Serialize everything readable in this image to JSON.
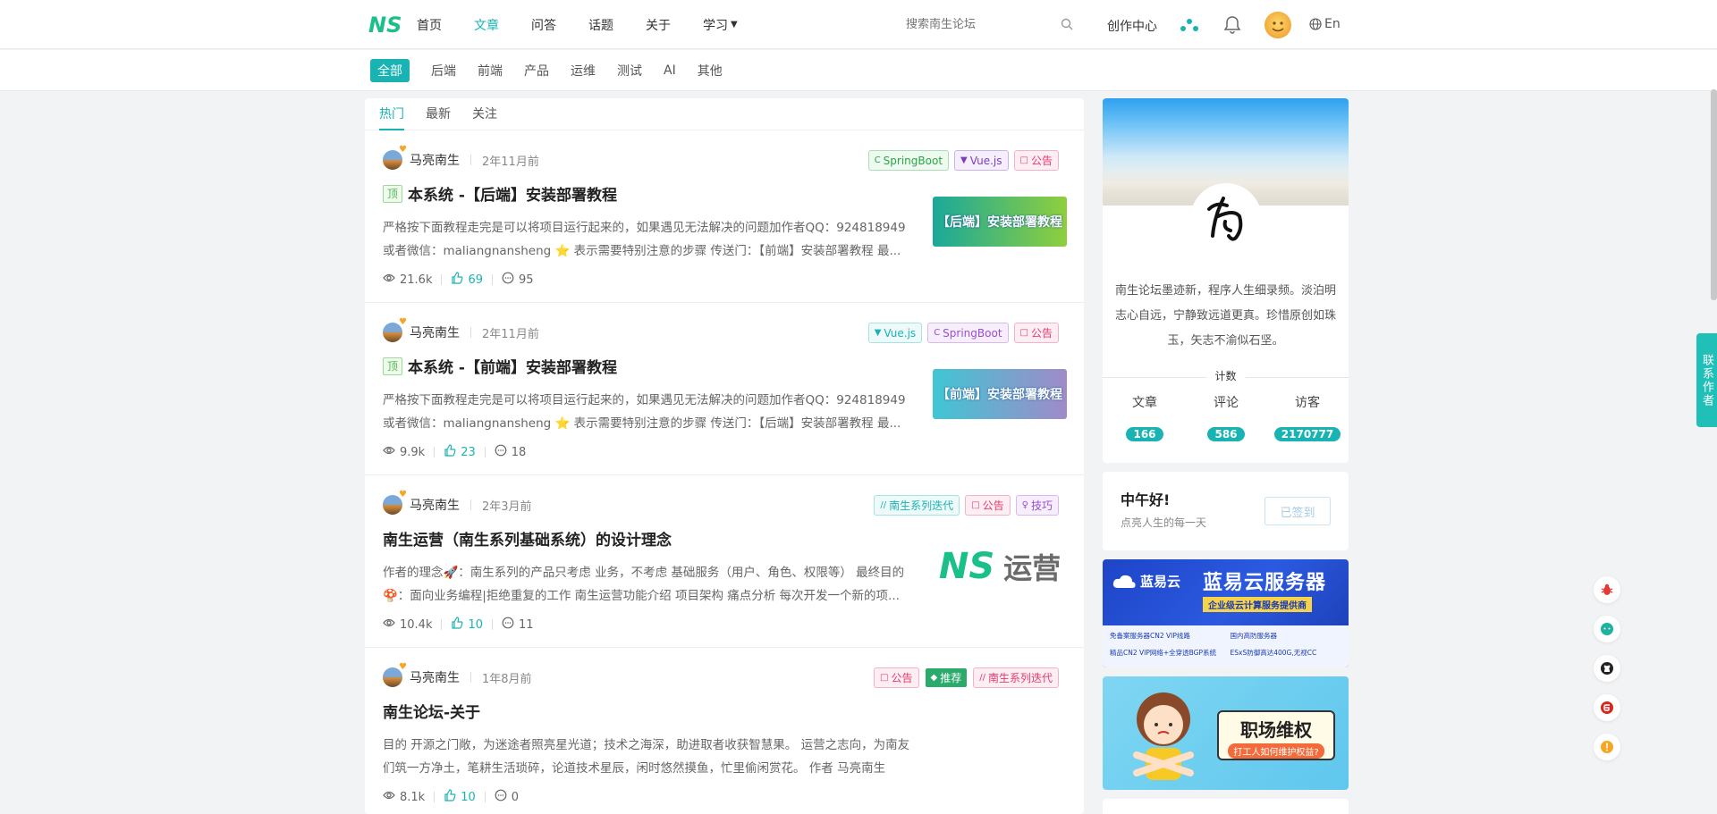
{
  "header": {
    "nav": [
      {
        "label": "首页",
        "active": false
      },
      {
        "label": "文章",
        "active": true
      },
      {
        "label": "问答",
        "active": false
      },
      {
        "label": "话题",
        "active": false
      },
      {
        "label": "关于",
        "active": false
      },
      {
        "label": "学习",
        "active": false,
        "dropdown": true
      }
    ],
    "search_placeholder": "搜索南生论坛",
    "create_label": "创作中心",
    "lang_label": "En"
  },
  "categories": [
    "全部",
    "后端",
    "前端",
    "产品",
    "运维",
    "测试",
    "AI",
    "其他"
  ],
  "feed_tabs": [
    "热门",
    "最新",
    "关注"
  ],
  "articles": [
    {
      "author": "马亮南生",
      "time": "2年11月前",
      "tags": [
        {
          "icon": "C",
          "label": "SpringBoot",
          "color": "#28a745",
          "bg": "#eef9f0"
        },
        {
          "icon": "▼",
          "label": "Vue.js",
          "color": "#7a3fb8",
          "bg": "#f5eefc"
        },
        {
          "icon": "□",
          "label": "公告",
          "color": "#e43b6e",
          "bg": "#fdeef3"
        }
      ],
      "pinned": true,
      "pin_label": "顶",
      "title": "本系统 -【后端】安装部署教程",
      "summary": "严格按下面教程走完是可以将项目运行起来的，如果遇见无法解决的问题加作者QQ：924818949 或者微信：maliangnansheng ⭐ 表示需要特别注意的步骤 传送门：【前端】安装部署教程 最...",
      "views": "21.6k",
      "likes": "69",
      "comments": "95",
      "thumb_text": "【后端】安装部署教程",
      "thumb_color1": "#1aa89a",
      "thumb_color2": "#8fcf3d"
    },
    {
      "author": "马亮南生",
      "time": "2年11月前",
      "tags": [
        {
          "icon": "▼",
          "label": "Vue.js",
          "color": "#1ab3b3",
          "bg": "#eefafa"
        },
        {
          "icon": "C",
          "label": "SpringBoot",
          "color": "#9b4fcf",
          "bg": "#f7eefc"
        },
        {
          "icon": "□",
          "label": "公告",
          "color": "#e43b6e",
          "bg": "#fdeef3"
        }
      ],
      "pinned": true,
      "pin_label": "顶",
      "title": "本系统 -【前端】安装部署教程",
      "summary": "严格按下面教程走完是可以将项目运行起来的，如果遇见无法解决的问题加作者QQ：924818949 或者微信：maliangnansheng ⭐ 表示需要特别注意的步骤 传送门：【后端】安装部署教程 最...",
      "views": "9.9k",
      "likes": "23",
      "comments": "18",
      "thumb_text": "【前端】安装部署教程",
      "thumb_color1": "#3fc6d4",
      "thumb_color2": "#a08ac8"
    },
    {
      "author": "马亮南生",
      "time": "2年3月前",
      "tags": [
        {
          "icon": "//",
          "label": "南生系列迭代",
          "color": "#1ab3b3",
          "bg": "#eefafa"
        },
        {
          "icon": "□",
          "label": "公告",
          "color": "#e43b6e",
          "bg": "#fdeef3"
        },
        {
          "icon": "♀",
          "label": "技巧",
          "color": "#9b4fcf",
          "bg": "#f7eefc"
        }
      ],
      "pinned": false,
      "title": "南生运营（南生系列基础系统）的设计理念",
      "summary": "作者的理念🚀：南生系列的产品只考虑 业务，不考虑 基础服务（用户、角色、权限等） 最终目的🍄：面向业务编程|拒绝重复的工作 南生运营功能介绍 项目架构 痛点分析 每次开发一个新的项...",
      "views": "10.4k",
      "likes": "10",
      "comments": "11",
      "thumb_logo": "NS",
      "thumb_text": "运营"
    },
    {
      "author": "马亮南生",
      "time": "1年8月前",
      "tags": [
        {
          "icon": "□",
          "label": "公告",
          "color": "#e43b6e",
          "bg": "#fdeef3"
        },
        {
          "icon": "◆",
          "label": "推荐",
          "color": "#fff",
          "bg": "#2bab6b"
        },
        {
          "icon": "//",
          "label": "南生系列迭代",
          "color": "#e43b6e",
          "bg": "#fdeef3"
        }
      ],
      "pinned": false,
      "title": "南生论坛-关于",
      "summary": "目的 开源之门敞，为迷途者照亮星光道；技术之海深，助进取者收获智慧果。 运营之志向，为南友们筑一方净土，笔耕生活琐碎，论道技术星辰，闲时悠然摸鱼，忙里偷闲赏花。 作者 马亮南生（maliangnansheng） 日常迭代 ✔ 表示已经开源 ...",
      "views": "8.1k",
      "likes": "10",
      "comments": "0"
    }
  ],
  "profile": {
    "bio": "南生论坛墨迹新，程序人生细录频。淡泊明志心自远，宁静致远道更真。珍惜原创如珠玉，矢志不渝似石坚。",
    "stats_title": "计数",
    "stats": [
      {
        "label": "文章",
        "value": "166"
      },
      {
        "label": "评论",
        "value": "586"
      },
      {
        "label": "访客",
        "value": "2170777"
      }
    ]
  },
  "checkin": {
    "greeting": "中午好!",
    "subtitle": "点亮人生的每一天",
    "button": "已签到"
  },
  "ads": {
    "ad1_brand": "蓝易云",
    "ad1_title": "蓝易云服务器",
    "ad1_sub": "企业级云计算服务提供商",
    "ad1_lines": [
      "免备案服务器CN2 VIP线路",
      "国内高防服务器",
      "精品CN2 VIP网络+全穿透BGP系统",
      "ESxS防御高达400G,无视CC"
    ],
    "ad2_title": "职场维权",
    "ad2_sub": "打工人如何维护权益?"
  },
  "contact_tab": "联系作者",
  "colors": {
    "accent": "#1ab3b3"
  }
}
